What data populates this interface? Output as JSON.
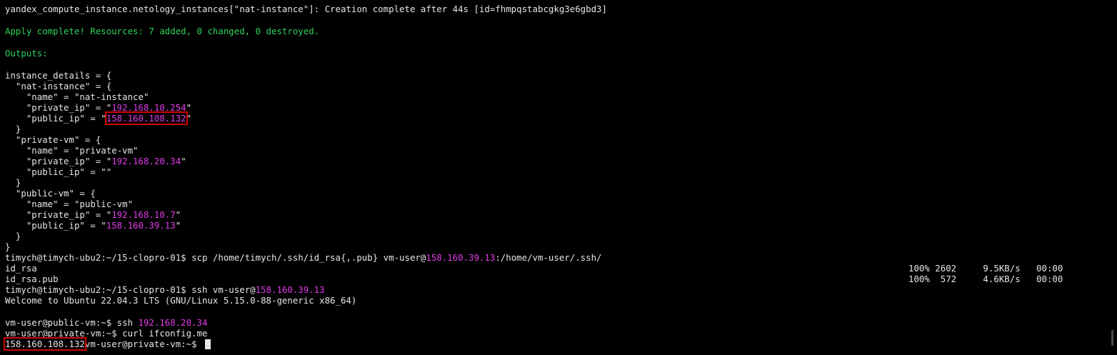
{
  "terminal": {
    "lines": [
      "yandex_compute_instance.netology_instances[\"nat-instance\"]: Creation complete after 44s [id=fhmpqstabcgkg3e6gbd3]",
      "",
      "Apply complete! Resources: 7 added, 0 changed, 0 destroyed.",
      "",
      "Outputs:",
      "",
      "instance_details = {",
      "  \"nat-instance\" = {",
      "    \"name\" = \"nat-instance\"",
      "    \"private_ip\" = \"",
      "192.168.10.254",
      "\"",
      "    \"public_ip\" = \"",
      "158.160.108.132",
      "\"",
      "  }",
      "  \"private-vm\" = {",
      "    \"name\" = \"private-vm\"",
      "    \"private_ip\" = \"",
      "192.168.20.34",
      "\"",
      "    \"public_ip\" = \"\"",
      "  }",
      "  \"public-vm\" = {",
      "    \"name\" = \"public-vm\"",
      "    \"private_ip\" = \"",
      "192.168.10.7",
      "\"",
      "    \"public_ip\" = \"",
      "158.160.39.13",
      "\"",
      "  }",
      "}",
      "timych@timych-ubu2:~/15-clopro-01$ scp /home/timych/.ssh/id_rsa{,.pub} vm-user@",
      "158.160.39.13",
      ":/home/vm-user/.ssh/",
      "id_rsa",
      "100% 2602     9.5KB/s   00:00",
      "id_rsa.pub",
      "100%  572     4.6KB/s   00:00",
      "timych@timych-ubu2:~/15-clopro-01$ ssh vm-user@",
      "158.160.39.13",
      "Welcome to Ubuntu 22.04.3 LTS (GNU/Linux 5.15.0-88-generic x86_64)",
      "",
      "vm-user@public-vm:~$ ssh ",
      "192.168.20.34",
      "vm-user@private-vm:~$ curl ifconfig.me",
      "158.160.108.132",
      "vm-user@private-vm:~$ "
    ]
  },
  "colors": {
    "background": "#000000",
    "text": "#e6e6e6",
    "success": "#2fd25c",
    "ip_highlight": "#e13ce7",
    "annotation_box": "#d30000"
  }
}
